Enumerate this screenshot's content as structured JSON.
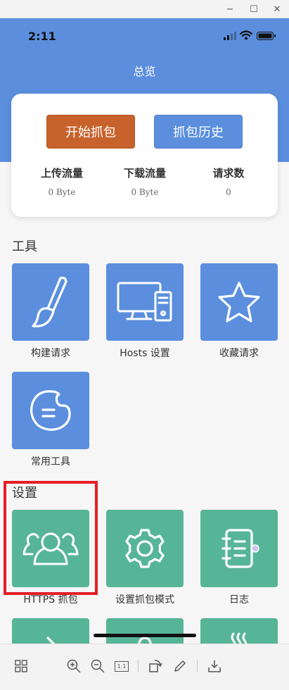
{
  "window": {
    "controls": {
      "minimize": "−",
      "maximize": "☐",
      "close": "✕"
    }
  },
  "status_bar": {
    "time": "2:11"
  },
  "header": {
    "title": "总览"
  },
  "capture_card": {
    "start_button": "开始抓包",
    "history_button": "抓包历史",
    "stats": [
      {
        "label": "上传流量",
        "value": "0 Byte"
      },
      {
        "label": "下载流量",
        "value": "0 Byte"
      },
      {
        "label": "请求数",
        "value": "0"
      }
    ]
  },
  "tools_section": {
    "title": "工具",
    "items": [
      {
        "label": "构建请求",
        "icon": "paintbrush-icon"
      },
      {
        "label": "Hosts 设置",
        "icon": "computer-icon"
      },
      {
        "label": "收藏请求",
        "icon": "star-icon"
      },
      {
        "label": "常用工具",
        "icon": "palette-icon"
      }
    ]
  },
  "settings_section": {
    "title": "设置",
    "items": [
      {
        "label": "HTTPS 抓包",
        "icon": "users-icon"
      },
      {
        "label": "设置抓包模式",
        "icon": "gear-icon"
      },
      {
        "label": "日志",
        "icon": "notebook-icon"
      }
    ]
  },
  "colors": {
    "header_blue": "#5b8fde",
    "start_orange": "#c8622c",
    "tool_tile_blue": "#5b8fde",
    "settings_tile_green": "#57b597",
    "highlight_red": "#e41e26"
  },
  "toolbar": {
    "icons": [
      "grid-icon",
      "zoom-in-icon",
      "zoom-out-icon",
      "actual-size-icon",
      "rotate-icon",
      "edit-icon",
      "save-icon"
    ],
    "actual_size_label": "1:1"
  }
}
